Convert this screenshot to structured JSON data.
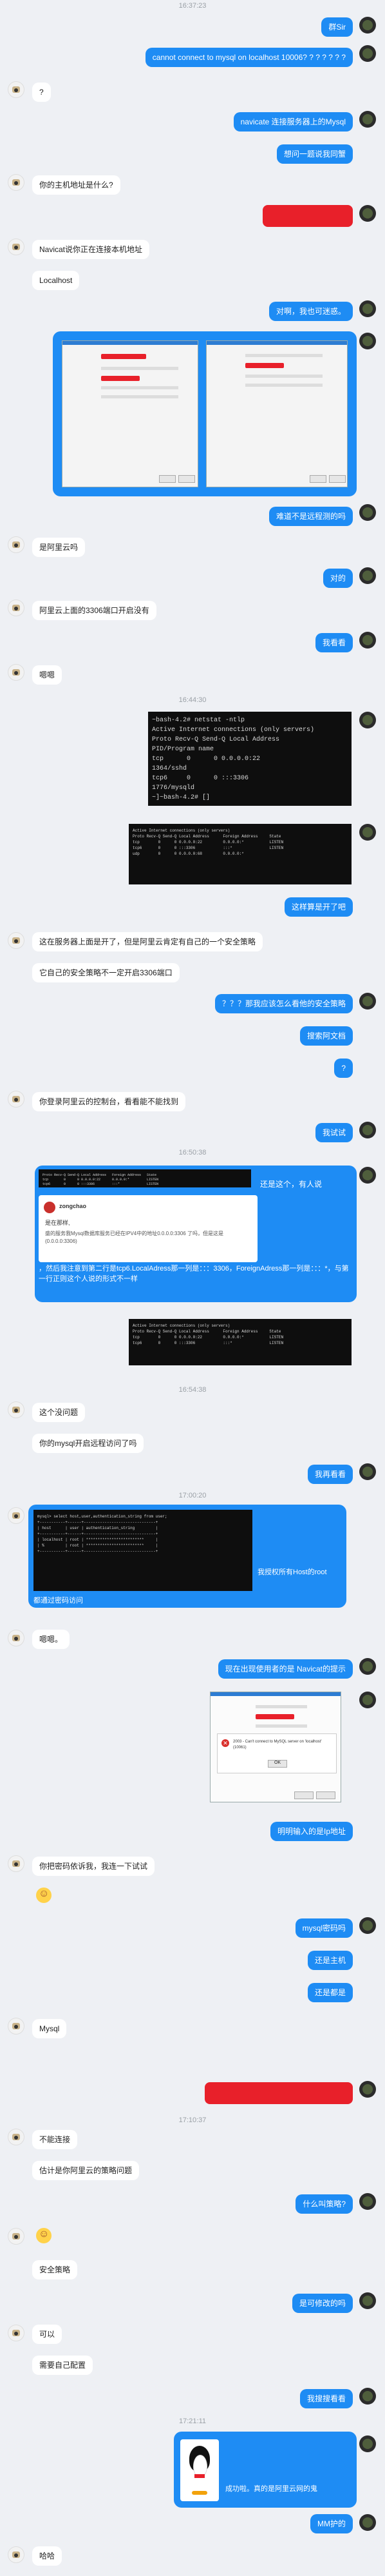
{
  "timestamps": [
    "16:37:23",
    "16:44:30",
    "16:50:38",
    "16:54:38",
    "17:00:20",
    "17:10:37",
    "17:21:11"
  ],
  "messages": {
    "m1": "群Sir",
    "m2": "cannot connect to mysql on localhost 10006? ? ? ? ? ? ?",
    "m3": "?",
    "m4": "navicate 连接服务器上的Mysql",
    "m5": "想问一题说我同蟹",
    "m6": "你的主机地址是什么?",
    "m7": "Navicat说你正在连接本机地址",
    "m8": "Localhost",
    "m9": "对啊，我也可迷惑。",
    "m10": "难道不是远程测的吗",
    "m11": "是阿里云吗",
    "m12": "对的",
    "m13": "阿里云上面的3306端口开启没有",
    "m14": "我看看",
    "m15": "嗯嗯",
    "m16": "这样算是开了吧",
    "m17": "这在服务器上面是开了，但是阿里云肯定有自己的一个安全策略",
    "m18": "它自己的安全策略不一定开启3306端口",
    "m19": "？？？那我应该怎么看他的安全策略",
    "m20": "搜索阿文档",
    "m21": "?",
    "m22": "你登录阿里云的控制台，看看能不能找到",
    "m23": "我试试",
    "m24_a": "还是这个，有人说",
    "m24_b": "，然后我注意到第二行是tcp6.LocalAdress那一列是：：：3306，ForeignAdress那一列是：：：*，与第一行正则这个人说的形式不一样",
    "m25": "这个没问题",
    "m26": "你的mysql开启远程访问了吗",
    "m27": "我再看看",
    "m28_a": "我授权所有Host的root",
    "m28_b": "都通过密码访问",
    "m29": "嗯嗯。",
    "m30": "现在出现使用者的是 Navicat的提示",
    "m31": "明明输入的是Ip地址",
    "m32": "你把密码依诉我，我连一下试试",
    "m33": "mysql密码吗",
    "m34": "还是主机",
    "m35": "还是都是",
    "m36": "Mysql",
    "m37": "不能连接",
    "m38": "估计是你阿里云的策略问题",
    "m39": "什么叫策略?",
    "m40": "安全策略",
    "m41": "是可修改的吗",
    "m42": "可以",
    "m43": "需要自己配置",
    "m44": "我搜搜看看",
    "m45": "成功啦。真的是阿里云网的鬼",
    "m46": "MM护的",
    "m47": "哈哈"
  },
  "embedded": {
    "term1": "~bash-4.2# netstat -ntlp\nActive Internet connections (only servers)\nProto Recv-Q Send-Q Local Address\nPID/Program name\ntcp      0      0 0.0.0.0:22\n1364/sshd\ntcp6     0      0 :::3306\n1776/mysqld\n~]~bash-4.2# []",
    "term2": "Active Internet connections (only servers)\nProto Recv-Q Send-Q Local Address      Foreign Address     State\ntcp        0      0 0.0.0.0:22         0.0.0.0:*           LISTEN\ntcp6       0      0 :::3306            :::*                LISTEN\nudp        0      0 0.0.0.0:68         0.0.0.0:*",
    "term3": "Proto Recv-Q Send-Q Local Address   Foreign Address   State\ntcp        0      0 0.0.0.0:22      0.0.0.0:*         LISTEN\ntcp6       0      0 :::3306         :::*              LISTEN",
    "term4": "Active Internet connections (only servers)\nProto Recv-Q Send-Q Local Address      Foreign Address     State\ntcp        0      0 0.0.0.0:22         0.0.0.0:*           LISTEN\ntcp6       0      0 :::3306            :::*                LISTEN",
    "term5": "mysql> select host,user,authentication_string from user;\n+-----------+------+-------------------------------+\n| host      | user | authentication_string         |\n+-----------+------+-------------------------------+\n| localhost | root | *************************     |\n| %         | root | *************************     |\n+-----------+------+-------------------------------+",
    "quote_user": "zongchao",
    "quote_title": "是在那样,",
    "quote_body": "盛的服务我Mysql数据库服务已经在IPV4中的地址0.0.0.0:3306 了吗，但是这是(0.0.0.0:3306)",
    "error_text": "2003 - Can't connect to MySQL server on 'localhost' (10061)",
    "ok": "OK"
  }
}
